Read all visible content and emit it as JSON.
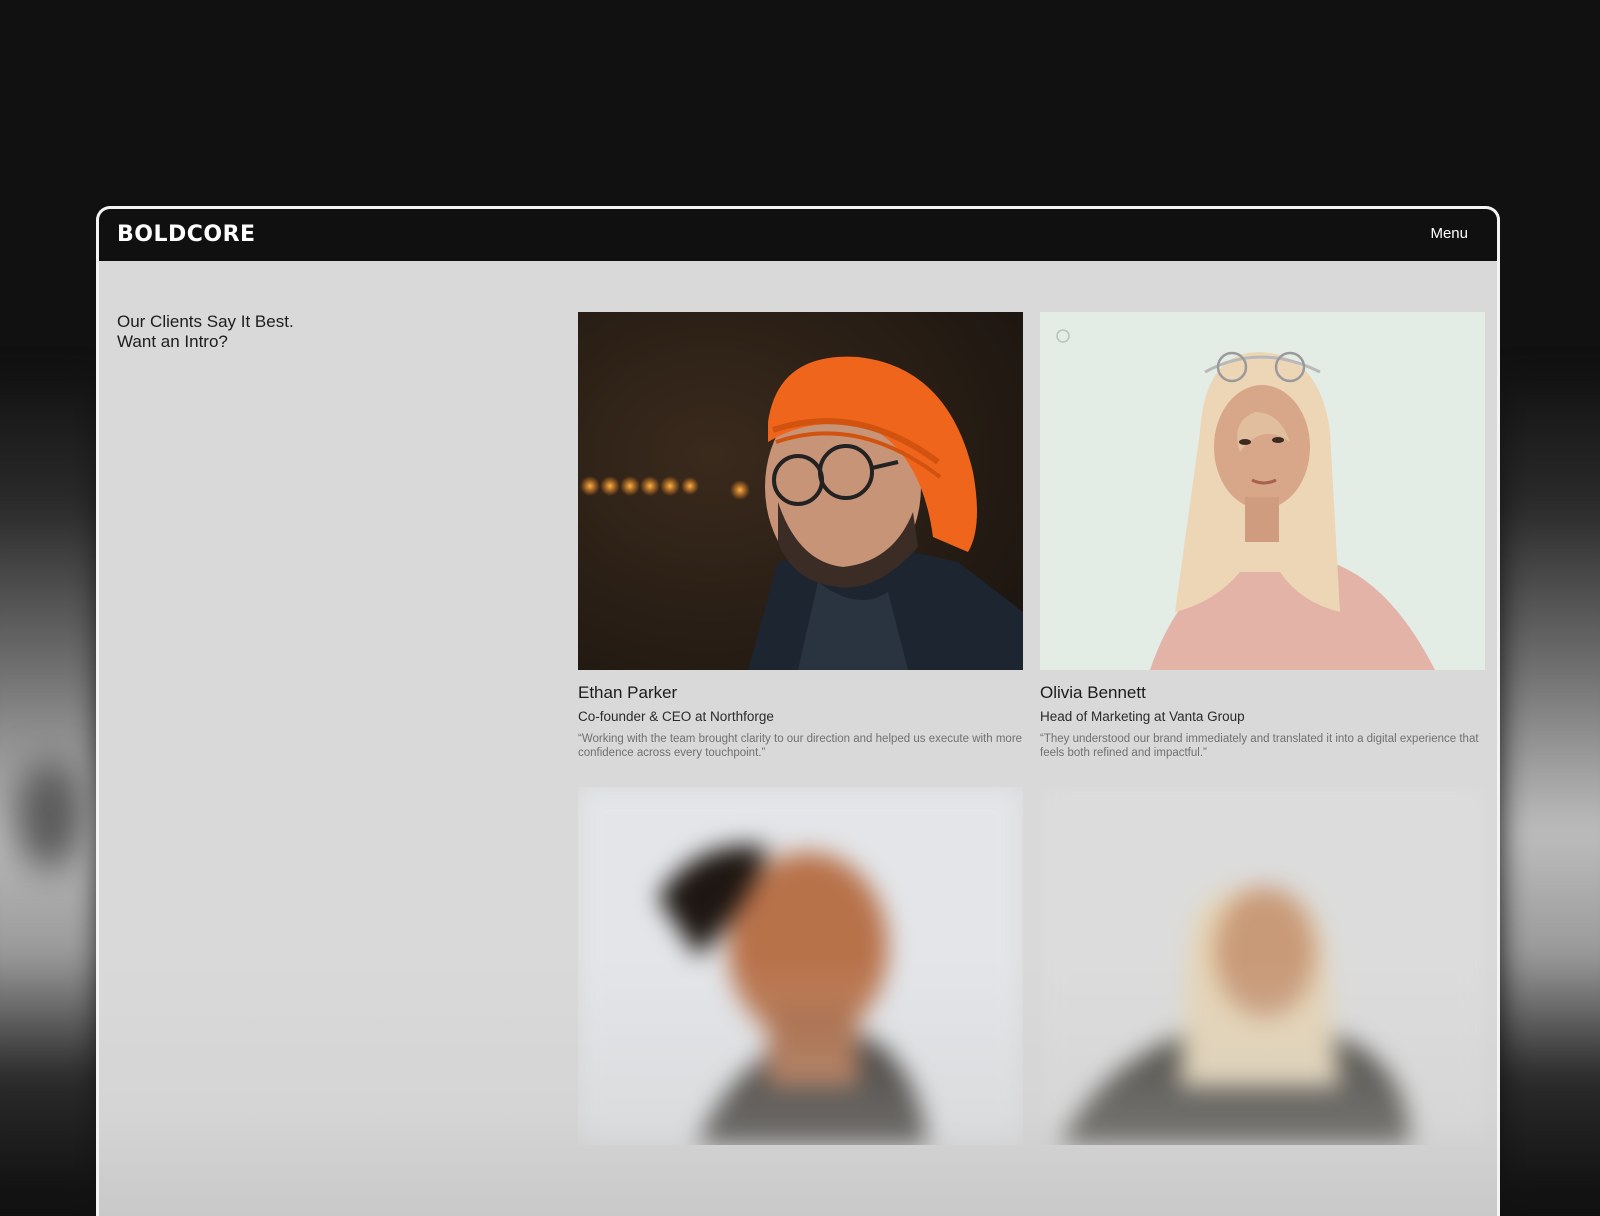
{
  "brand": {
    "logo_text": "BOLDCORE"
  },
  "header": {
    "menu_label": "Menu"
  },
  "section": {
    "headline_line1": "Our Clients Say It Best.",
    "headline_line2": "Want an Intro?"
  },
  "testimonials": [
    {
      "name": "Ethan Parker",
      "role": "Co-founder & CEO at Northforge",
      "quote": "“Working with the team brought clarity to our direction and helped us execute with more confidence across every touchpoint.”"
    },
    {
      "name": "Olivia Bennett",
      "role": "Head of Marketing at Vanta Group",
      "quote": "“They understood our brand immediately and translated it into a digital experience that feels both refined and impactful.”"
    },
    {
      "name": "",
      "role": "",
      "quote": ""
    },
    {
      "name": "",
      "role": "",
      "quote": ""
    }
  ],
  "colors": {
    "page_bg": "#111111",
    "frame_bg": "#d9d9d9",
    "topbar_bg": "#101010"
  }
}
